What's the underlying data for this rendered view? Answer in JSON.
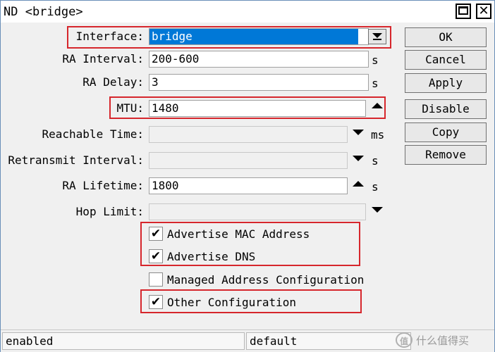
{
  "window": {
    "title": "ND <bridge>",
    "close_glyph": "✕"
  },
  "fields": {
    "interface": {
      "label": "Interface:",
      "value": "bridge"
    },
    "ra_interval": {
      "label": "RA Interval:",
      "value": "200-600",
      "unit": "s"
    },
    "ra_delay": {
      "label": "RA Delay:",
      "value": "3",
      "unit": "s"
    },
    "mtu": {
      "label": "MTU:",
      "value": "1480"
    },
    "reachable_time": {
      "label": "Reachable Time:",
      "value": "",
      "unit": "ms"
    },
    "retransmit_interval": {
      "label": "Retransmit Interval:",
      "value": "",
      "unit": "s"
    },
    "ra_lifetime": {
      "label": "RA Lifetime:",
      "value": "1800",
      "unit": "s"
    },
    "hop_limit": {
      "label": "Hop Limit:",
      "value": ""
    }
  },
  "checkboxes": [
    {
      "label": "Advertise MAC Address",
      "checked": true,
      "mark": "✔"
    },
    {
      "label": "Advertise DNS",
      "checked": true,
      "mark": "✔"
    },
    {
      "label": "Managed Address Configuration",
      "checked": false,
      "mark": ""
    },
    {
      "label": "Other Configuration",
      "checked": true,
      "mark": "✔"
    }
  ],
  "buttons": {
    "ok": "OK",
    "cancel": "Cancel",
    "apply": "Apply",
    "disable": "Disable",
    "copy": "Copy",
    "remove": "Remove"
  },
  "status": {
    "left": "enabled",
    "right": "default"
  },
  "watermark": {
    "logo": "值",
    "text": "什么值得买"
  },
  "colors": {
    "selection": "#0078d7",
    "highlight": "#d6262c"
  }
}
